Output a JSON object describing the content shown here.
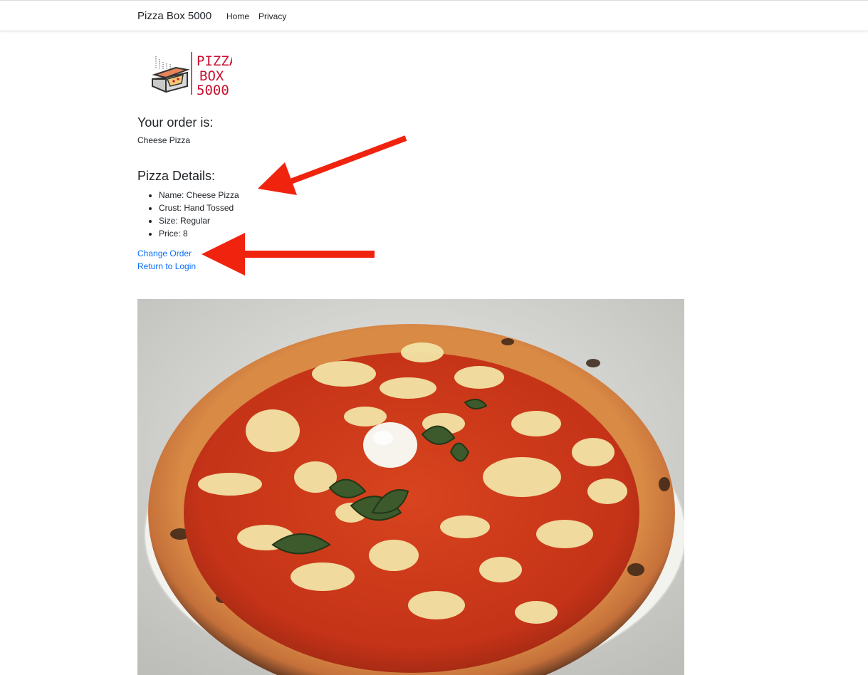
{
  "navbar": {
    "brand": "Pizza Box 5000",
    "links": [
      "Home",
      "Privacy"
    ]
  },
  "logo": {
    "line1": "PIZZA",
    "line2": "BOX",
    "line3": "5000",
    "accent_color": "#c8102e"
  },
  "order": {
    "heading": "Your order is:",
    "value": "Cheese Pizza"
  },
  "details": {
    "heading": "Pizza Details:",
    "items": [
      "Name: Cheese Pizza",
      "Crust: Hand Tossed",
      "Size: Regular",
      "Price: 8"
    ]
  },
  "links": {
    "change_order": "Change Order",
    "return_login": "Return to Login"
  },
  "colors": {
    "link": "#0d6efd",
    "annotation_arrow": "#f0230f"
  }
}
